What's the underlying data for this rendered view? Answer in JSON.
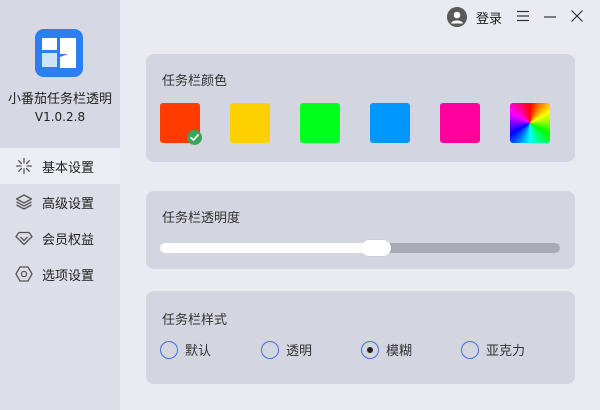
{
  "app": {
    "name": "小番茄任务栏透明",
    "version": "V1.0.2.8"
  },
  "topbar": {
    "login_label": "登录"
  },
  "sidebar": {
    "items": [
      {
        "label": "基本设置",
        "icon": "sparkle-icon",
        "active": true
      },
      {
        "label": "高级设置",
        "icon": "layers-icon",
        "active": false
      },
      {
        "label": "会员权益",
        "icon": "diamond-icon",
        "active": false
      },
      {
        "label": "选项设置",
        "icon": "hexagon-settings-icon",
        "active": false
      }
    ]
  },
  "color_card": {
    "title": "任务栏颜色",
    "swatches": [
      {
        "color": "#ff3b00",
        "selected": true
      },
      {
        "color": "#ffd000",
        "selected": false
      },
      {
        "color": "#00ff1a",
        "selected": false
      },
      {
        "color": "#0097ff",
        "selected": false
      },
      {
        "color": "#ff009c",
        "selected": false
      },
      {
        "color": "rainbow",
        "selected": false
      }
    ]
  },
  "opacity_card": {
    "title": "任务栏透明度",
    "value_percent": 54
  },
  "style_card": {
    "title": "任务栏样式",
    "options": [
      {
        "label": "默认",
        "selected": false
      },
      {
        "label": "透明",
        "selected": false
      },
      {
        "label": "模糊",
        "selected": true
      },
      {
        "label": "亚克力",
        "selected": false
      }
    ]
  },
  "colors": {
    "accent": "#3f73d8",
    "check": "#3aa45b",
    "logo": "#2d7ff0"
  }
}
